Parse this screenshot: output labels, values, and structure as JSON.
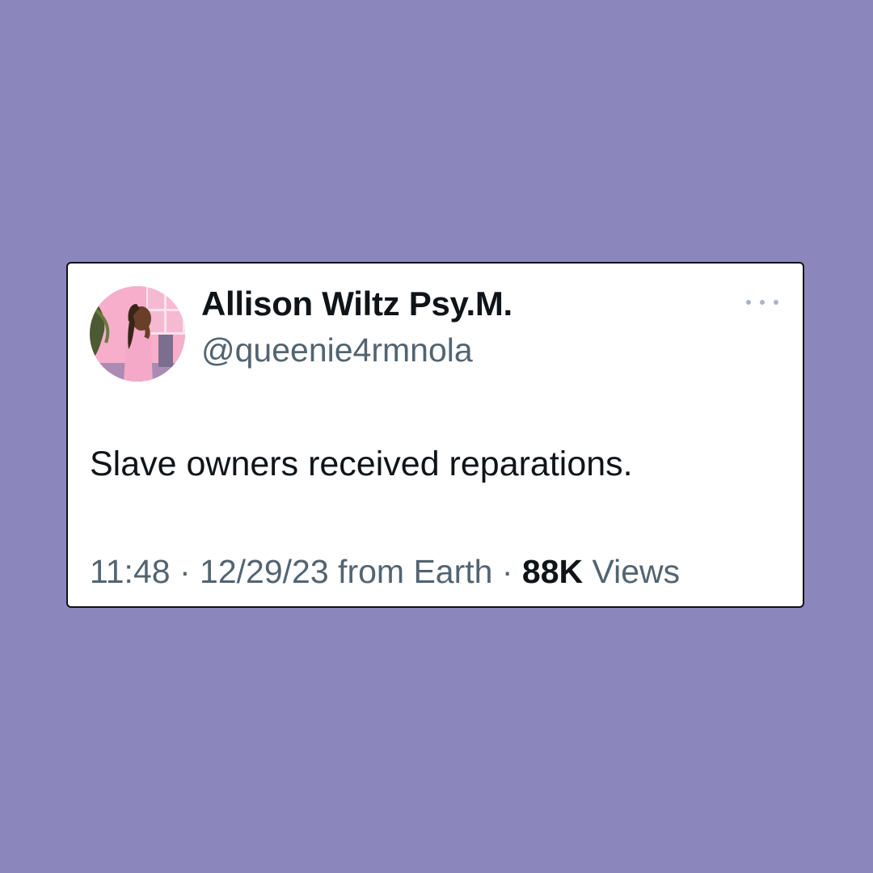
{
  "tweet": {
    "display_name": "Allison Wiltz Psy.M.",
    "handle": "@queenie4rmnola",
    "text": "Slave owners received reparations.",
    "time": "11:48",
    "separator": "·",
    "date": "12/29/23",
    "source": "from Earth",
    "views_count": "88K",
    "views_label": "Views",
    "avatar_icon": "profile-illustration-avatar",
    "more_icon": "more-options-icon"
  },
  "colors": {
    "background": "#8b87bc",
    "card": "#ffffff",
    "card_border": "#111111",
    "primary_text": "#0f1419",
    "secondary_text": "#536471"
  }
}
